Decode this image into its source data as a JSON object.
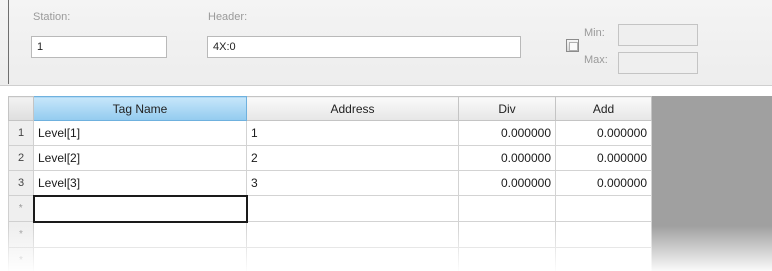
{
  "settings": {
    "station_label": "Station:",
    "station_value": "1",
    "header_label": "Header:",
    "header_value": "4X:0",
    "min_label": "Min:",
    "max_label": "Max:",
    "min_value": "",
    "max_value": "",
    "range_checked": false
  },
  "grid": {
    "columns": [
      "Tag Name",
      "Address",
      "Div",
      "Add"
    ],
    "rows": [
      {
        "index": "1",
        "tag_name": "Level[1]",
        "address": "1",
        "div": "0.000000",
        "add": "0.000000"
      },
      {
        "index": "2",
        "tag_name": "Level[2]",
        "address": "2",
        "div": "0.000000",
        "add": "0.000000"
      },
      {
        "index": "3",
        "tag_name": "Level[3]",
        "address": "3",
        "div": "0.000000",
        "add": "0.000000"
      }
    ],
    "new_row_marker": "*"
  }
}
